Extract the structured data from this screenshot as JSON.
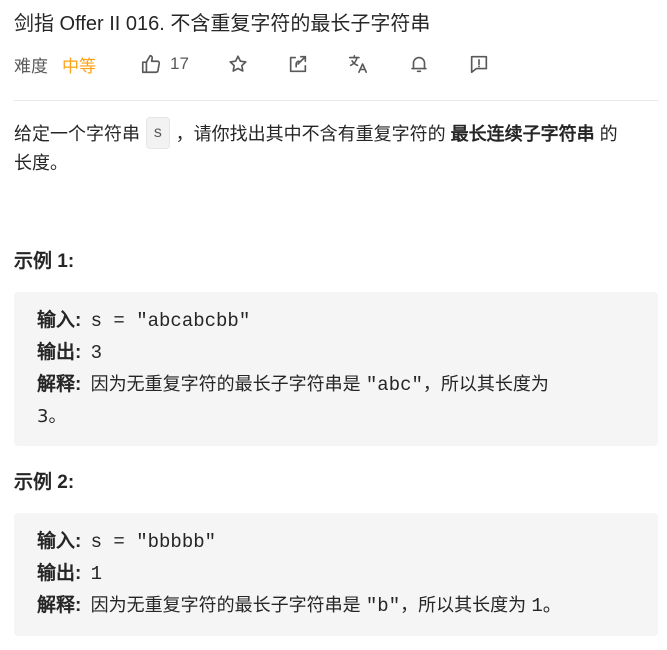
{
  "problem": {
    "title": "剑指 Offer II 016. 不含重复字符的最长子字符串",
    "difficulty_label": "难度",
    "difficulty": "中等",
    "difficulty_color": "#ffa116",
    "like_count": "17"
  },
  "toolbar_icons": [
    "thumbs-up-icon",
    "star-icon",
    "share-icon",
    "translate-icon",
    "bell-icon",
    "feedback-icon"
  ],
  "description": {
    "part1": "给定一个字符串",
    "code": "s",
    "part2": "，请你找出其中不含有重复字符的",
    "bold": "最长连续子字符串",
    "part3": "的长度。"
  },
  "examples": [
    {
      "title": "示例 1:",
      "input_label": "输入:",
      "input_value": "s = \"abcabcbb\"",
      "output_label": "输出:",
      "output_value": "3",
      "explain_label": "解释:",
      "explain_text_a": "因为无重复字符的最长子字符串是",
      "explain_code": "\"abc\"",
      "explain_text_b": "，所以其长度为",
      "explain_tail": "3。"
    },
    {
      "title": "示例 2:",
      "input_label": "输入:",
      "input_value": "s = \"bbbbb\"",
      "output_label": "输出:",
      "output_value": "1",
      "explain_label": "解释:",
      "explain_text_a": "因为无重复字符的最长子字符串是",
      "explain_code": "\"b\"",
      "explain_text_b": "，所以其长度为",
      "explain_tail": "1。"
    }
  ]
}
